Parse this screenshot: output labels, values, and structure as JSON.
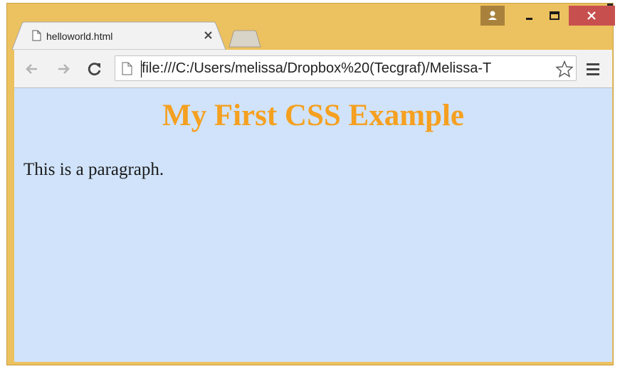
{
  "tab": {
    "title": "helloworld.html"
  },
  "address_bar": {
    "url": "file:///C:/Users/melissa/Dropbox%20(Tecgraf)/Melissa-T"
  },
  "page": {
    "heading": "My First CSS Example",
    "paragraph": "This is a paragraph.",
    "background_color": "#d0e3fa",
    "heading_color": "#f5a020"
  },
  "window": {
    "frame_color": "#ecc15f",
    "close_button_color": "#c7504f"
  },
  "icons": {
    "profile": "person-icon",
    "minimize": "minimize-icon",
    "maximize": "maximize-icon",
    "close": "close-icon",
    "tab_file": "file-icon",
    "tab_close": "tab-close-icon",
    "back": "back-arrow-icon",
    "forward": "forward-arrow-icon",
    "reload": "reload-icon",
    "page": "page-icon",
    "bookmark": "star-icon",
    "menu": "hamburger-menu-icon"
  }
}
